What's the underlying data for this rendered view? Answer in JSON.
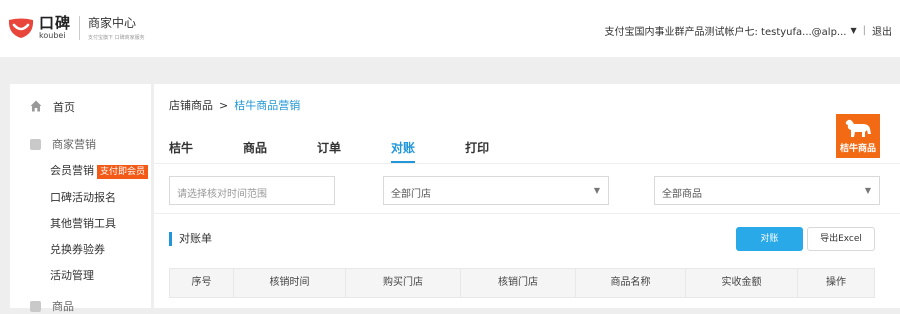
{
  "header": {
    "logo_cn": "口碑",
    "logo_en": "koubei",
    "center_title": "商家中心",
    "center_subtitle": "支付宝旗下 口碑商家服务",
    "account_text": "支付宝国内事业群产品测试帐户七: testyufa...@alp...",
    "logout": "退出",
    "brand_color": "#e8463b"
  },
  "sidebar": {
    "home": "首页",
    "group_marketing": "商家营销",
    "sub_items": [
      "会员营销",
      "口碑活动报名",
      "其他营销工具",
      "兑换券验券",
      "活动管理"
    ],
    "badge": "支付即会员",
    "group_goods": "商品"
  },
  "main": {
    "breadcrumb_parent": "店铺商品",
    "breadcrumb_sep": ">",
    "breadcrumb_current": "桔牛商品营销",
    "tabs": [
      {
        "label": "桔牛",
        "active": false
      },
      {
        "label": "商品",
        "active": false
      },
      {
        "label": "订单",
        "active": false
      },
      {
        "label": "对账",
        "active": true
      },
      {
        "label": "打印",
        "active": false
      }
    ],
    "brand_badge_text": "桔牛商品",
    "filters": {
      "date_placeholder": "请选择核对时间范围",
      "store_select": "全部门店",
      "goods_select": "全部商品"
    },
    "section_title": "对账单",
    "btn_check": "对账",
    "btn_export": "导出Excel",
    "table_headers": [
      "序号",
      "核销时间",
      "购买门店",
      "核销门店",
      "商品名称",
      "实收金额",
      "操作"
    ],
    "accent_color": "#2196d8",
    "brand_orange": "#f26a14"
  }
}
